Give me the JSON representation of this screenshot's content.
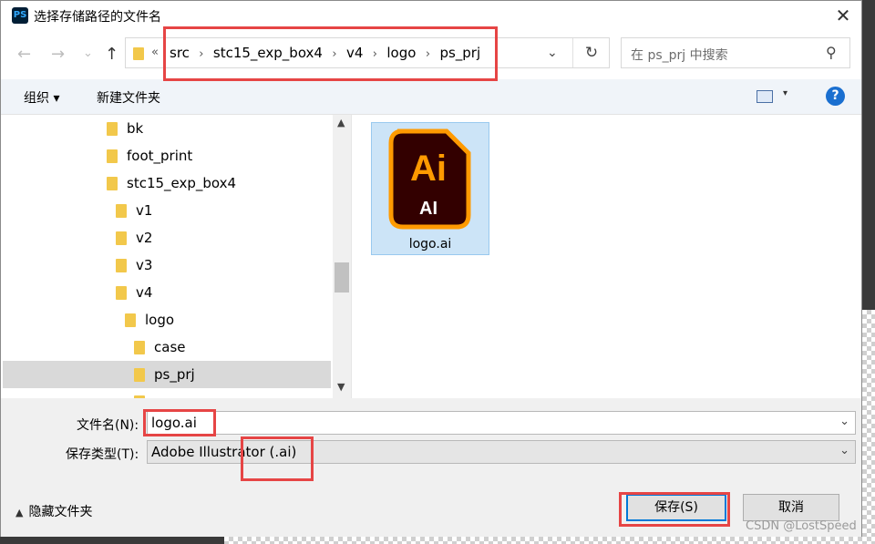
{
  "window": {
    "title": "选择存储路径的文件名",
    "app_icon": "PS"
  },
  "nav": {
    "back_glyph": "←",
    "forward_glyph": "→",
    "recent_glyph": "⌄",
    "up_glyph": "↑",
    "overflow": "«",
    "breadcrumbs": [
      "src",
      "stc15_exp_box4",
      "v4",
      "logo",
      "ps_prj"
    ],
    "separator": "›",
    "dropdown_glyph": "⌄",
    "refresh_glyph": "↻"
  },
  "search": {
    "placeholder": "在 ps_prj 中搜索",
    "icon_glyph": "⚲"
  },
  "toolbar": {
    "organize_label": "组织 ▾",
    "new_folder_label": "新建文件夹",
    "view_dropdown": "▾",
    "help_label": "?"
  },
  "tree": {
    "items": [
      {
        "label": "bk"
      },
      {
        "label": "foot_print"
      },
      {
        "label": "stc15_exp_box4"
      },
      {
        "label": "v1"
      },
      {
        "label": "v2"
      },
      {
        "label": "v3"
      },
      {
        "label": "v4"
      },
      {
        "label": "logo"
      },
      {
        "label": "case"
      },
      {
        "label": "ps_prj",
        "selected": true
      }
    ],
    "scroll_up": "▲",
    "scroll_down": "▼"
  },
  "content": {
    "files": [
      {
        "name": "logo.ai",
        "icon": "adobe-illustrator-icon",
        "icon_text_large": "Ai",
        "icon_text_small": "AI"
      }
    ]
  },
  "form": {
    "filename_label": "文件名(N):",
    "filename_value": "logo.ai",
    "filetype_label": "保存类型(T):",
    "filetype_value": "Adobe Illustrator (.ai)",
    "dropdown_glyph": "⌄"
  },
  "footer": {
    "hide_folders_label": "隐藏文件夹",
    "hide_folders_glyph": "▲",
    "save_label": "保存(S)",
    "cancel_label": "取消"
  },
  "watermark": "CSDN @LostSpeed",
  "colors": {
    "accent": "#0078d7",
    "highlight_box": "#e64545",
    "ai_dark": "#330000",
    "ai_orange": "#ff9a00"
  }
}
